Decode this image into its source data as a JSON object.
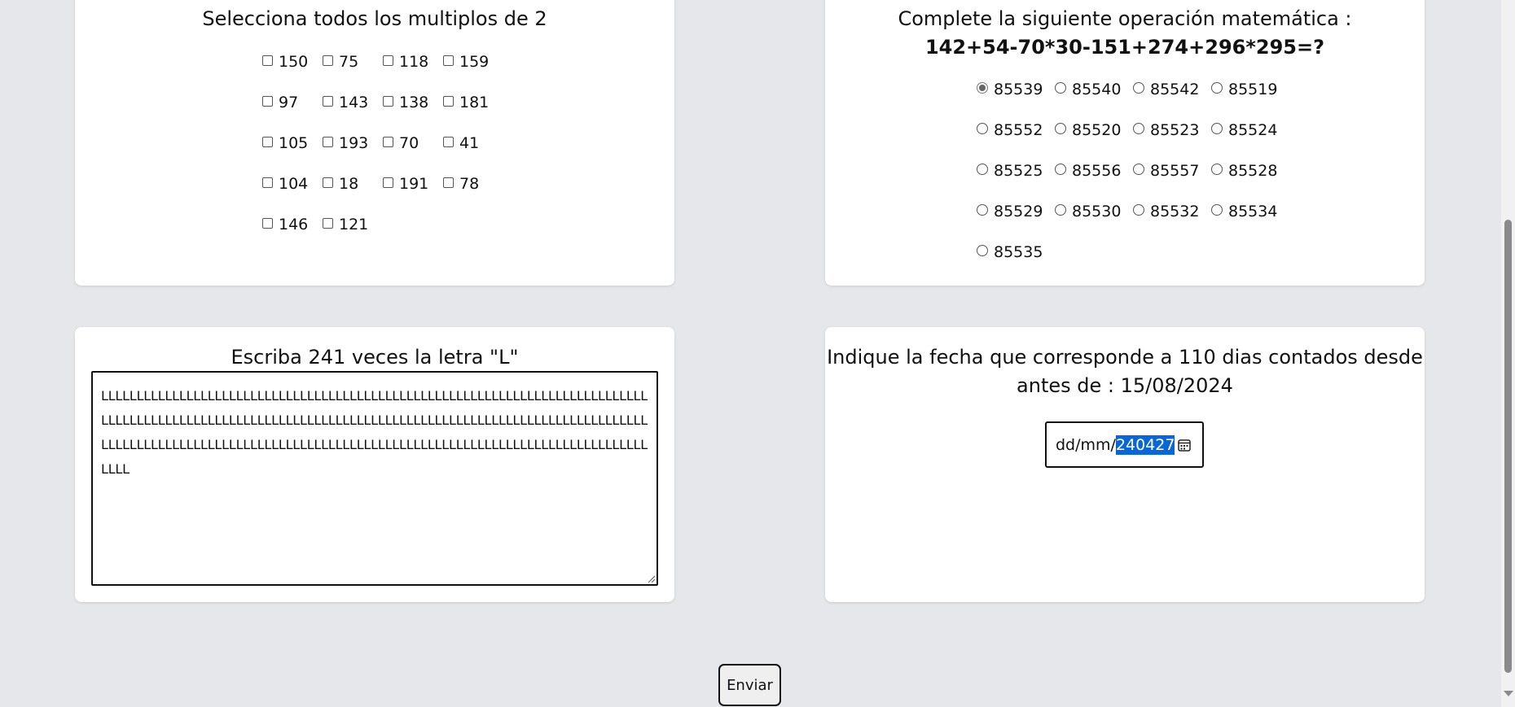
{
  "multiples": {
    "title": "Selecciona todos los multiplos de 2",
    "options": [
      "150",
      "75",
      "118",
      "159",
      "97",
      "143",
      "138",
      "181",
      "105",
      "193",
      "70",
      "41",
      "104",
      "18",
      "191",
      "78",
      "146",
      "121"
    ]
  },
  "math": {
    "title": "Complete la siguiente operación matemática :",
    "expression": "142+54-70*30-151+274+296*295=?",
    "options": [
      "85539",
      "85540",
      "85542",
      "85519",
      "85552",
      "85520",
      "85523",
      "85524",
      "85525",
      "85556",
      "85557",
      "85528",
      "85529",
      "85530",
      "85532",
      "85534",
      "85535"
    ],
    "selected": "85539"
  },
  "letters": {
    "title": "Escriba 241 veces la letra \"L\"",
    "value": "LLLLLLLLLLLLLLLLLLLLLLLLLLLLLLLLLLLLLLLLLLLLLLLLLLLLLLLLLLLLLLLLLLLLLLLLLLLLLLLLLLLLLLLLLLLLLLLLLLLLLLLLLLLLLLLLLLLLLLLLLLLLLLLLLLLLLLLLLLLLLLLLLLLLLLLLLLLLLLLLLLLLLLLLLLLLLLLLLLLLLLLLLLLLLLLLLLLLLLLLLLLLLLLLLLLLLLLLLLLLLLLLLLLLLLLLLLL"
  },
  "date": {
    "title_line1": "Indique la fecha que corresponde a 110 dias contados desde",
    "title_line2": "antes de : 15/08/2024",
    "prefix": "dd/mm/",
    "year_selected": "240427",
    "icon": "calendar-icon"
  },
  "submit": {
    "label": "Enviar"
  },
  "colors": {
    "selection": "#0a66d4",
    "background": "#e5e7eb"
  }
}
